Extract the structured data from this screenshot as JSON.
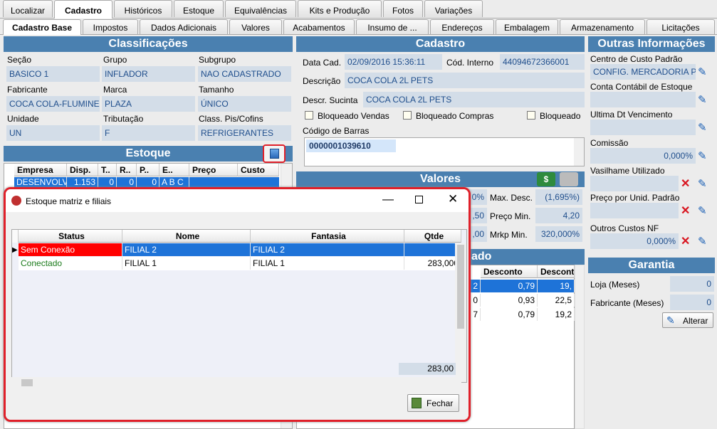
{
  "main_tabs": [
    "Localizar",
    "Cadastro",
    "Históricos",
    "Estoque",
    "Equivalências",
    "Kits e Produção",
    "Fotos",
    "Variações"
  ],
  "sub_tabs": [
    "Cadastro Base",
    "Impostos",
    "Dados Adicionais",
    "Valores",
    "Acabamentos",
    "Insumo de ...",
    "Endereços",
    "Embalagem",
    "Armazenamento",
    "Licitações"
  ],
  "classificacoes": {
    "title": "Classificações",
    "secao_label": "Seção",
    "secao": "BASICO 1",
    "grupo_label": "Grupo",
    "grupo": "INFLADOR",
    "subgrupo_label": "Subgrupo",
    "subgrupo": "NAO CADASTRADO",
    "fabricante_label": "Fabricante",
    "fabricante": "COCA COLA-FLUMINE",
    "marca_label": "Marca",
    "marca": "PLAZA",
    "tamanho_label": "Tamanho",
    "tamanho": "ÚNICO",
    "unidade_label": "Unidade",
    "unidade": "UN",
    "tributacao_label": "Tributação",
    "tributacao": "F",
    "pis_label": "Class. Pis/Cofins",
    "pis": "REFRIGERANTES"
  },
  "estoque": {
    "title": "Estoque",
    "cols": [
      "Empresa",
      "Disp.",
      "T..",
      "R..",
      "P..",
      "E..",
      "Preço",
      "Custo"
    ],
    "row": [
      "DESENVOLV",
      "1.153",
      "0",
      "0",
      "0",
      "A B C",
      "",
      ""
    ]
  },
  "cadastro": {
    "title": "Cadastro",
    "data_label": "Data Cad.",
    "data": "02/09/2016 15:36:11",
    "cod_label": "Cód. Interno",
    "cod": "44094672366001",
    "descricao_label": "Descrição",
    "descricao": "COCA COLA 2L PETS",
    "sucinta_label": "Descr. Sucinta",
    "sucinta": "COCA COLA 2L PETS",
    "bloq_vendas": "Bloqueado Vendas",
    "bloq_compras": "Bloqueado Compras",
    "bloq": "Bloqueado",
    "barras_label": "Código de Barras",
    "barras": "0000001039610"
  },
  "valores": {
    "title": "Valores",
    "pct": "0%",
    "max_desc_label": "Max. Desc.",
    "max_desc": "(1,695%)",
    "v2": ",50",
    "preco_min_label": "Preço Min.",
    "preco_min": "4,20",
    "v3": ",00",
    "mrkp_label": "Mrkp Min.",
    "mrkp": "320,000%"
  },
  "precos": {
    "title": "ado",
    "cols": [
      "Desconto",
      "Desconto"
    ],
    "rows": [
      [
        "2",
        "0,79",
        "19,"
      ],
      [
        "0",
        "0,93",
        "22,5"
      ],
      [
        "7",
        "0,79",
        "19,2"
      ]
    ]
  },
  "outras": {
    "title": "Outras Informações",
    "centro_label": "Centro de Custo Padrão",
    "centro": "CONFIG. MERCADORIA P.",
    "conta_label": "Conta Contábil de Estoque",
    "conta": "",
    "ult_label": "Ultima Dt Vencimento",
    "ult": "",
    "comissao_label": "Comissão",
    "comissao": "0,000%",
    "vasilhame_label": "Vasilhame Utilizado",
    "vasilhame": "",
    "preco_unid_label": "Preço por Unid. Padrão",
    "preco_unid": "",
    "outros_label": "Outros Custos NF",
    "outros": "0,000%"
  },
  "garantia": {
    "title": "Garantia",
    "loja_label": "Loja (Meses)",
    "loja": "0",
    "fab_label": "Fabricante (Meses)",
    "fab": "0",
    "alterar": "Alterar"
  },
  "dialog": {
    "title": "Estoque matriz e filiais",
    "cols": [
      "Status",
      "Nome",
      "Fantasia",
      "Qtde"
    ],
    "rows": [
      {
        "status": "Sem Conexão",
        "nome": "FILIAL 2",
        "fantasia": "FILIAL 2",
        "qtde": ""
      },
      {
        "status": "Conectado",
        "nome": "FILIAL 1",
        "fantasia": "FILIAL 1",
        "qtde": "283,000"
      }
    ],
    "total": "283,00",
    "fechar": "Fechar"
  }
}
